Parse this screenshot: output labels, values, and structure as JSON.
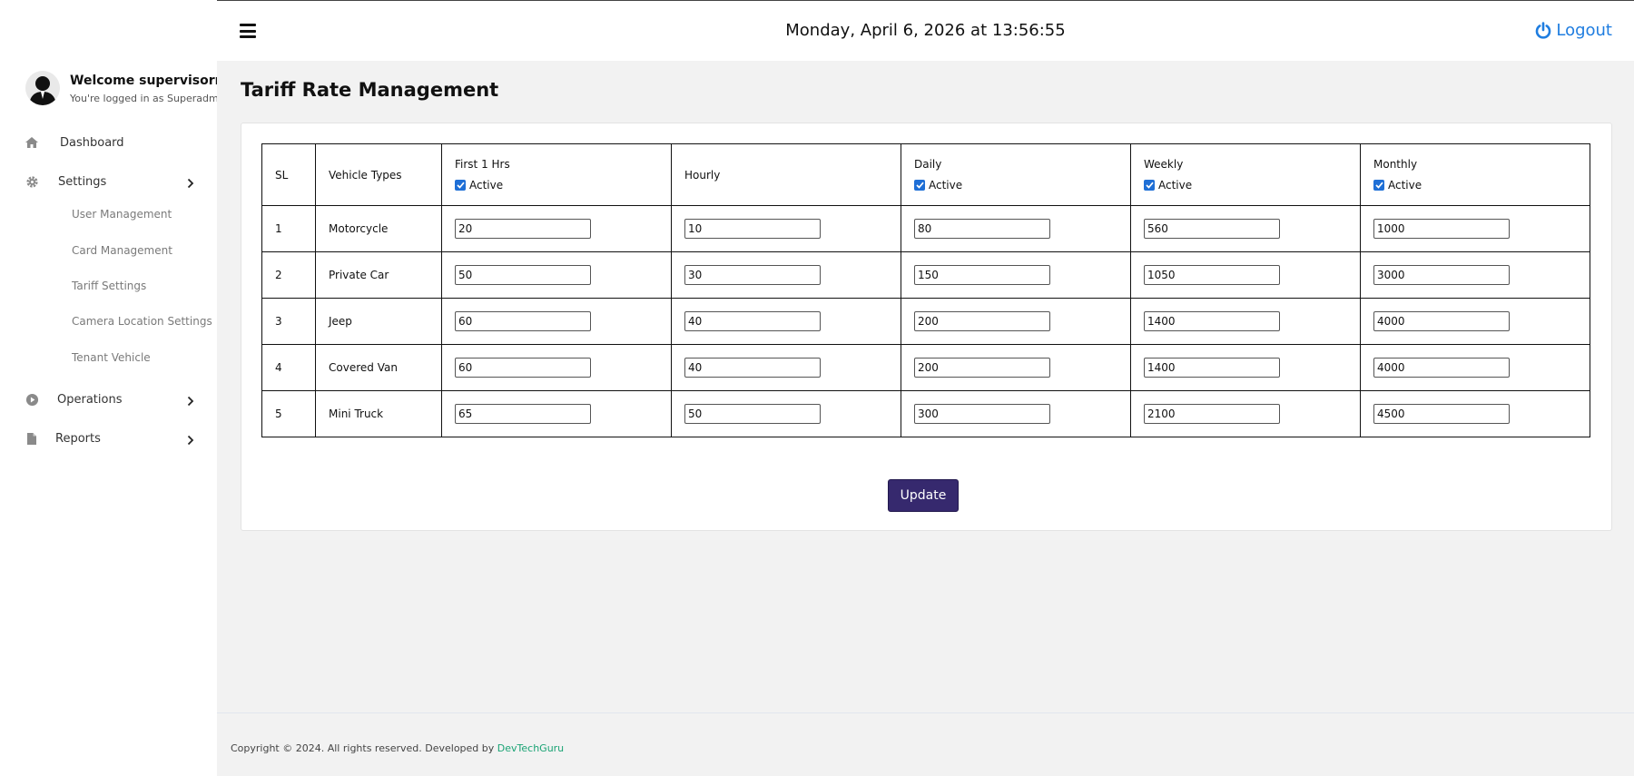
{
  "sidebar": {
    "welcome": "Welcome supervisormain",
    "role_text": "You're logged in as Superadmin",
    "nav": [
      {
        "label": "Dashboard",
        "icon": "home-icon"
      },
      {
        "label": "Settings",
        "icon": "gear-icon"
      },
      {
        "label": "Operations",
        "icon": "play-circle-icon"
      },
      {
        "label": "Reports",
        "icon": "file-icon"
      }
    ],
    "settings_sub": [
      "User Management",
      "Card Management",
      "Tariff Settings",
      "Camera Location Settings",
      "Tenant Vehicle"
    ]
  },
  "topbar": {
    "datetime": "Monday, April 6, 2026 at 13:56:55",
    "logout_label": "Logout"
  },
  "main": {
    "title": "Tariff Rate Management",
    "table": {
      "headers": {
        "sl": "SL",
        "vehicle_types": "Vehicle Types",
        "first": "First 1 Hrs",
        "hourly": "Hourly",
        "daily": "Daily",
        "weekly": "Weekly",
        "monthly": "Monthly",
        "active_label": "Active"
      },
      "active": {
        "first": true,
        "hourly": false,
        "daily": true,
        "weekly": true,
        "monthly": true
      },
      "rows": [
        {
          "sl": "1",
          "type": "Motorcycle",
          "first": "20",
          "hourly": "10",
          "daily": "80",
          "weekly": "560",
          "monthly": "1000"
        },
        {
          "sl": "2",
          "type": "Private Car",
          "first": "50",
          "hourly": "30",
          "daily": "150",
          "weekly": "1050",
          "monthly": "3000"
        },
        {
          "sl": "3",
          "type": "Jeep",
          "first": "60",
          "hourly": "40",
          "daily": "200",
          "weekly": "1400",
          "monthly": "4000"
        },
        {
          "sl": "4",
          "type": "Covered Van",
          "first": "60",
          "hourly": "40",
          "daily": "200",
          "weekly": "1400",
          "monthly": "4000"
        },
        {
          "sl": "5",
          "type": "Mini Truck",
          "first": "65",
          "hourly": "50",
          "daily": "300",
          "weekly": "2100",
          "monthly": "4500"
        }
      ]
    },
    "update_label": "Update"
  },
  "footer": {
    "text": "Copyright © 2024. All rights reserved. Developed by ",
    "link": "DevTechGuru"
  },
  "colors": {
    "accent_link": "#1f7de0",
    "button": "#36296e",
    "footer_link": "#1aa374"
  }
}
